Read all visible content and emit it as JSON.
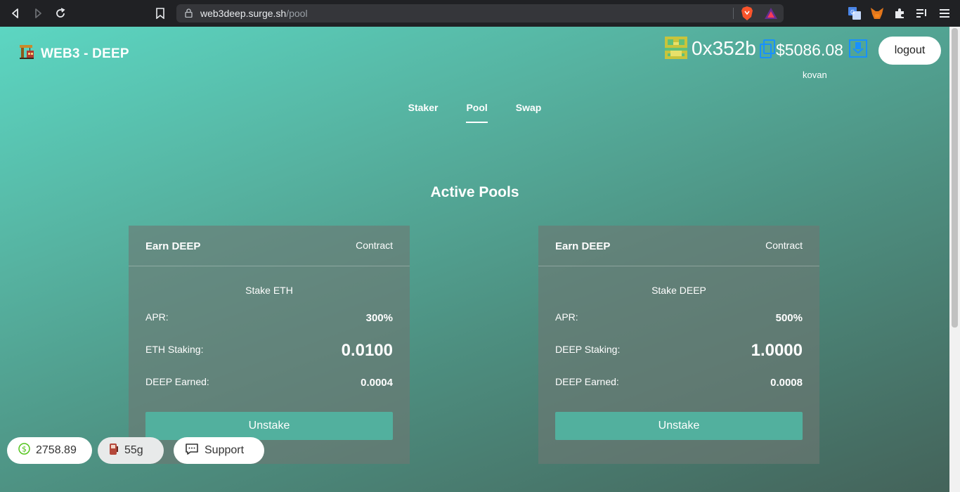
{
  "browser": {
    "url_host": "web3deep.surge.sh",
    "url_path": "/pool"
  },
  "app": {
    "title": "WEB3 - DEEP"
  },
  "account": {
    "address": "0x352b",
    "balance": "$5086.08",
    "network": "kovan",
    "logout_label": "logout"
  },
  "nav": {
    "tabs": [
      {
        "label": "Staker"
      },
      {
        "label": "Pool"
      },
      {
        "label": "Swap"
      }
    ],
    "active": "Pool"
  },
  "main": {
    "section_title": "Active Pools",
    "pools": [
      {
        "title": "Earn DEEP",
        "contract_label": "Contract",
        "stake_label": "Stake ETH",
        "apr_label": "APR:",
        "apr": "300%",
        "staking_label": "ETH Staking:",
        "staking": "0.0100",
        "earned_label": "DEEP Earned:",
        "earned": "0.0004",
        "button_label": "Unstake"
      },
      {
        "title": "Earn DEEP",
        "contract_label": "Contract",
        "stake_label": "Stake DEEP",
        "apr_label": "APR:",
        "apr": "500%",
        "staking_label": "DEEP Staking:",
        "staking": "1.0000",
        "earned_label": "DEEP Earned:",
        "earned": "0.0008",
        "button_label": "Unstake"
      }
    ]
  },
  "footer": {
    "price": "2758.89",
    "gas": "55g",
    "support_label": "Support"
  },
  "colors": {
    "accent": "#52b09e",
    "gradient_start": "#5cd6c2",
    "gradient_end": "#44635a"
  }
}
